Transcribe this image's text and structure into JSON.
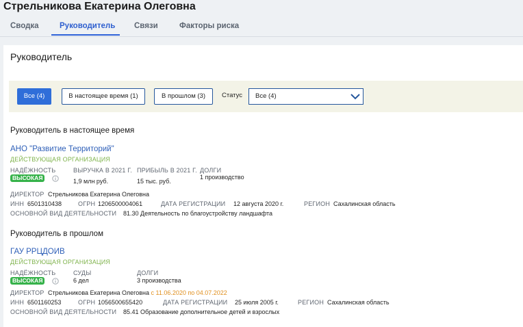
{
  "person": {
    "name": "Стрельникова Екатерина Олеговна"
  },
  "tabs": [
    {
      "label": "Сводка"
    },
    {
      "label": "Руководитель"
    },
    {
      "label": "Связи"
    },
    {
      "label": "Факторы риска"
    }
  ],
  "section": {
    "title": "Руководитель"
  },
  "filters": {
    "all": "Все (4)",
    "now": "В настоящее время (1)",
    "past": "В прошлом (3)",
    "status_label": "Статус",
    "status_value": "Все (4)"
  },
  "current": {
    "title": "Руководитель в настоящее время",
    "org": {
      "name": "АНО \"Развитие Территорий\"",
      "status": "ДЕЙСТВУЮЩАЯ ОРГАНИЗАЦИЯ",
      "reliability_label": "НАДЁЖНОСТЬ",
      "reliability_value": "ВЫСОКАЯ",
      "revenue_label": "ВЫРУЧКА В 2021 Г.",
      "revenue_value": "1,9 млн руб.",
      "profit_label": "ПРИБЫЛЬ В 2021 Г.",
      "profit_value": "15 тыс. руб.",
      "debts_label": "ДОЛГИ",
      "debts_value": "1 производство",
      "director_label": "ДИРЕКТОР",
      "director_value": "Стрельникова Екатерина Олеговна",
      "inn_label": "ИНН",
      "inn_value": "6501310438",
      "ogrn_label": "ОГРН",
      "ogrn_value": "1206500004061",
      "reg_label": "ДАТА РЕГИСТРАЦИИ",
      "reg_value": "12 августа 2020 г.",
      "region_label": "РЕГИОН",
      "region_value": "Сахалинская область",
      "activity_label": "ОСНОВНОЙ ВИД ДЕЯТЕЛЬНОСТИ",
      "activity_value": "81.30 Деятельность по благоустройству ландшафта"
    }
  },
  "past": {
    "title": "Руководитель в прошлом",
    "org": {
      "name": "ГАУ РРЦДОИВ",
      "status": "ДЕЙСТВУЮЩАЯ ОРГАНИЗАЦИЯ",
      "reliability_label": "НАДЁЖНОСТЬ",
      "reliability_value": "ВЫСОКАЯ",
      "courts_label": "СУДЫ",
      "courts_value": "6 дел",
      "debts_label": "ДОЛГИ",
      "debts_value": "3 производства",
      "director_label": "ДИРЕКТОР",
      "director_value": "Стрельникова Екатерина Олеговна",
      "director_period": "с 11.06.2020 по 04.07.2022",
      "inn_label": "ИНН",
      "inn_value": "6501160253",
      "ogrn_label": "ОГРН",
      "ogrn_value": "1056500655420",
      "reg_label": "ДАТА РЕГИСТРАЦИИ",
      "reg_value": "25 июля 2005 г.",
      "region_label": "РЕГИОН",
      "region_value": "Сахалинская область",
      "activity_label": "ОСНОВНОЙ ВИД ДЕЯТЕЛЬНОСТИ",
      "activity_value": "85.41 Образование дополнительное детей и взрослых"
    }
  },
  "icons": {
    "info": "info-icon",
    "chevron": "chevron-down-icon"
  },
  "colors": {
    "accent": "#2e62d8",
    "link": "#2e5fb8",
    "active_status": "#7fb34c",
    "badge": "#36b24a",
    "period": "#e09020"
  }
}
